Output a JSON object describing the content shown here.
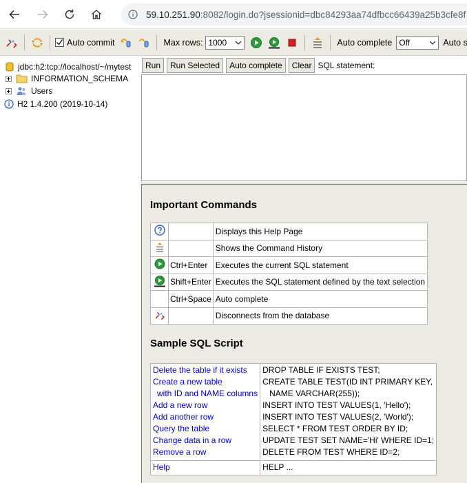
{
  "browser": {
    "url_host": "59.10.251.90",
    "url_rest": ":8082/login.do?jsessionid=dbc84293aa74dfbcc66439a25b3cfe8f"
  },
  "toolbar": {
    "auto_commit_label": "Auto commit",
    "auto_commit_checked": true,
    "max_rows_label": "Max rows:",
    "max_rows_value": "1000",
    "auto_complete_label": "Auto complete",
    "auto_complete_value": "Off",
    "auto_select_label": "Auto select"
  },
  "tree": {
    "connection": "jdbc:h2:tcp://localhost/~/mytest",
    "schema": "INFORMATION_SCHEMA",
    "users": "Users",
    "version": "H2 1.4.200 (2019-10-14)"
  },
  "query": {
    "run": "Run",
    "run_selected": "Run Selected",
    "auto_complete": "Auto complete",
    "clear": "Clear",
    "sql_label": "SQL statement:",
    "sql_text": ""
  },
  "help": {
    "commands_title": "Important Commands",
    "commands": [
      {
        "icon": "help-icon",
        "key": "",
        "desc": "Displays this Help Page"
      },
      {
        "icon": "history-icon",
        "key": "",
        "desc": "Shows the Command History"
      },
      {
        "icon": "run-icon",
        "key": "Ctrl+Enter",
        "desc": "Executes the current SQL statement"
      },
      {
        "icon": "run-selected-icon",
        "key": "Shift+Enter",
        "desc": "Executes the SQL statement defined by the text selection"
      },
      {
        "icon": "",
        "key": "Ctrl+Space",
        "desc": "Auto complete"
      },
      {
        "icon": "disconnect-icon",
        "key": "",
        "desc": "Disconnects from the database"
      }
    ],
    "sample_title": "Sample SQL Script",
    "sample_left": [
      "Delete the table if it exists",
      "Create a new table",
      "with ID and NAME columns",
      "Add a new row",
      "Add another row",
      "Query the table",
      "Change data in a row",
      "Remove a row"
    ],
    "sample_right": [
      "DROP TABLE IF EXISTS TEST;",
      "CREATE TABLE TEST(ID INT PRIMARY KEY,",
      "NAME VARCHAR(255));",
      "INSERT INTO TEST VALUES(1, 'Hello');",
      "INSERT INTO TEST VALUES(2, 'World');",
      "SELECT * FROM TEST ORDER BY ID;",
      "UPDATE TEST SET NAME='Hi' WHERE ID=1;",
      "DELETE FROM TEST WHERE ID=2;"
    ],
    "help_link": "Help",
    "help_cmd": "HELP ..."
  },
  "colors": {
    "panel_bg": "#ecebe3",
    "link": "#0000cc",
    "run_green": "#2e9b3a",
    "stop_red": "#d42020"
  }
}
